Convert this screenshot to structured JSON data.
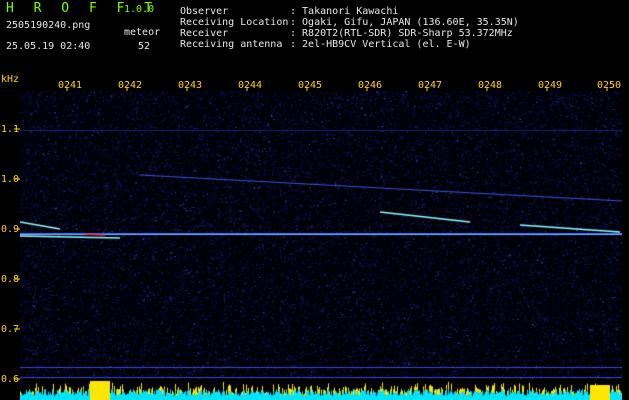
{
  "app": {
    "name": "H R O F F T",
    "version": "1.0.0"
  },
  "file": {
    "name": "2505190240.png",
    "datetime": "25.05.19 02:40"
  },
  "counter": {
    "label": "meteor",
    "value": "52"
  },
  "info": {
    "observer_label": "Observer",
    "observer": ": Takanori Kawachi",
    "location_label": "Receiving Location",
    "location": ": Ogaki, Gifu, JAPAN (136.60E, 35.35N)",
    "receiver_label": "Receiver",
    "receiver": ": R820T2(RTL-SDR) SDR-Sharp 53.372MHz",
    "antenna_label": "Receiving antenna",
    "antenna": ": 2el-HB9CV Vertical (el. E-W)"
  },
  "axis": {
    "y_unit": "kHz",
    "x_ticks": [
      "0241",
      "0242",
      "0243",
      "0244",
      "0245",
      "0246",
      "0247",
      "0248",
      "0249",
      "0250"
    ],
    "y_ticks": [
      "1.1",
      "1.0",
      "0.9",
      "0.8",
      "0.7",
      "0.6"
    ]
  },
  "colors": {
    "background": "#000000",
    "noise": "#1a2a8a",
    "carrier": "#4a7cff",
    "echo": "#9ffcff",
    "tick_text": "#FFD700",
    "title": "#7CFC00",
    "histogram_cyan": "#00e5ff",
    "histogram_yellow": "#ffe600"
  }
}
